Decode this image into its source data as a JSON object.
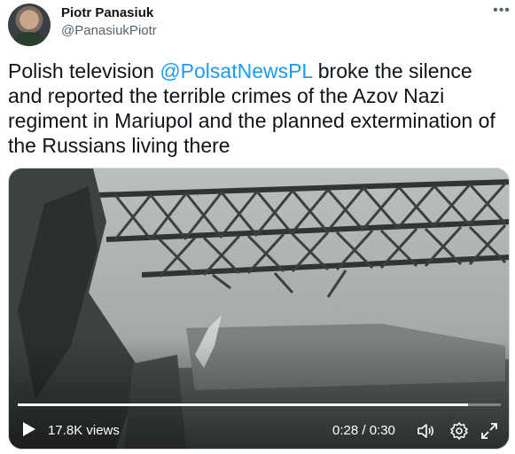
{
  "author": {
    "display_name": "Piotr Panasiuk",
    "handle": "@PanasiukPiotr"
  },
  "more_icon": "more-horizontal-icon",
  "tweet": {
    "text_before": "Polish television ",
    "mention": "@PolsatNewsPL",
    "text_after": "  broke the silence and reported the terrible crimes of the Azov Nazi regiment in Mariupol and the planned extermination of the Russians living there"
  },
  "video": {
    "views": "17.8K views",
    "time": "0:28 / 0:30",
    "progress": 0.933,
    "icons": [
      "play-icon",
      "volume-icon",
      "settings-icon",
      "fullscreen-icon"
    ]
  },
  "colors": {
    "link": "#1d9bf0",
    "secondary_text": "#536471",
    "primary_text": "#0f1419"
  }
}
